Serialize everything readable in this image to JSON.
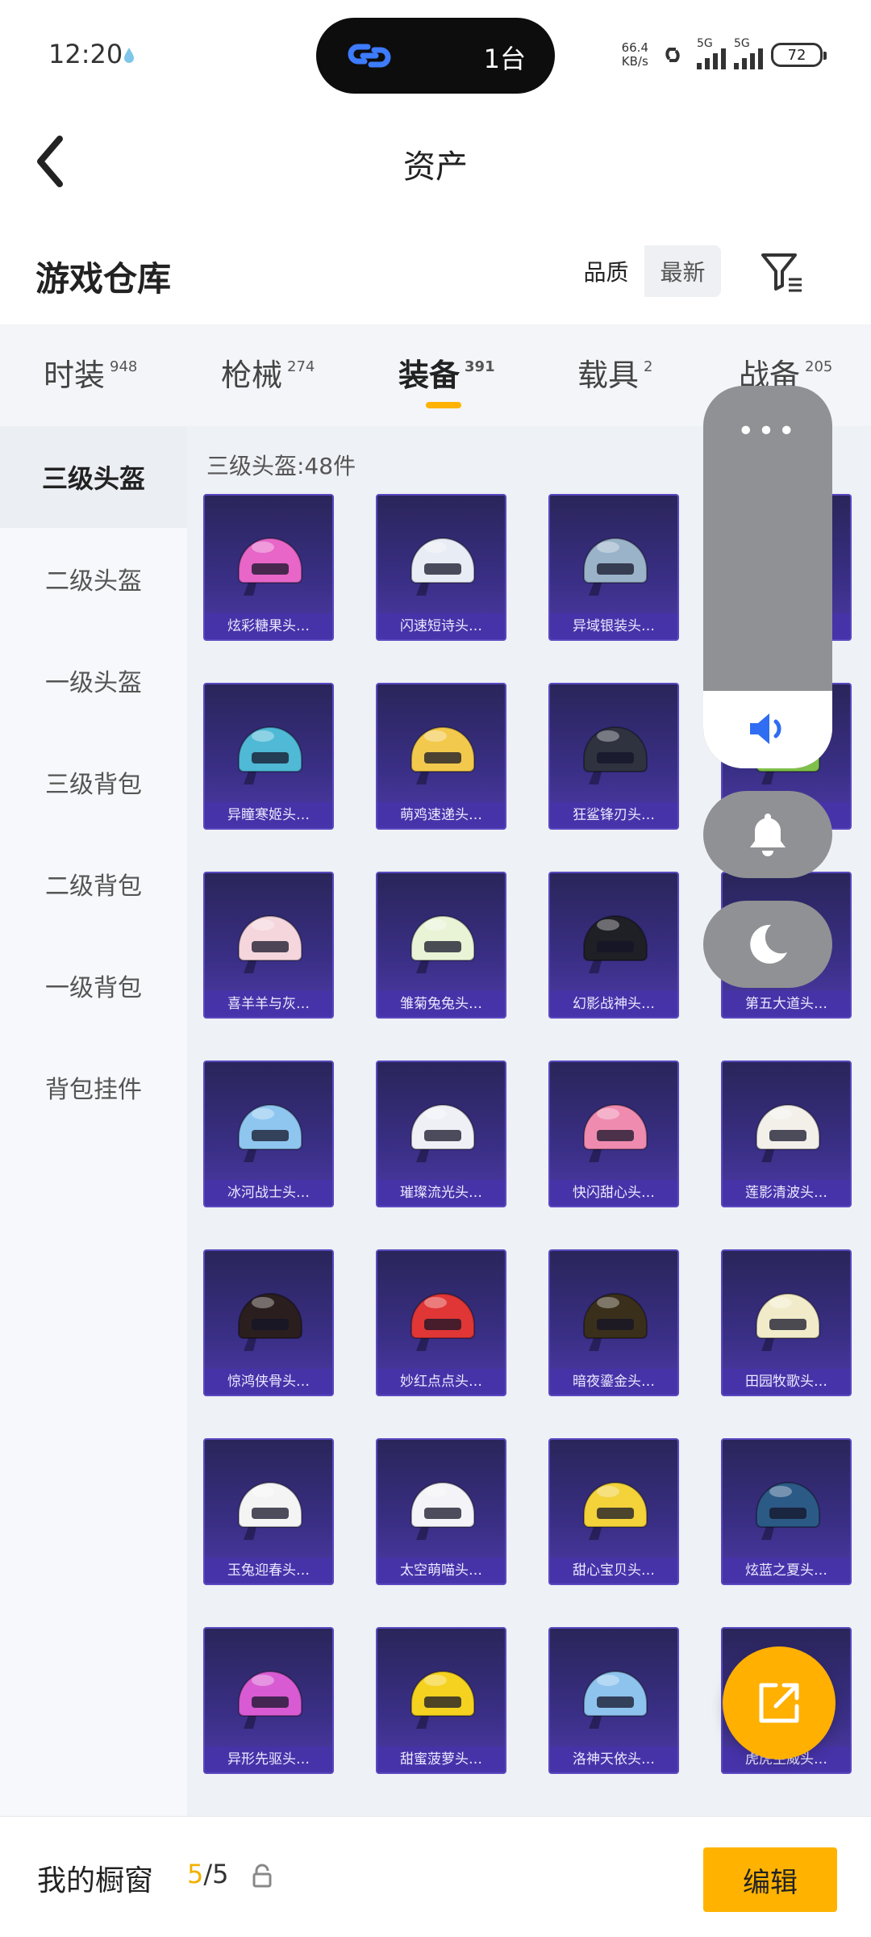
{
  "status_bar": {
    "time": "12:20",
    "island_text": "1台",
    "net_speed_top": "66.4",
    "net_speed_unit": "KB/s",
    "sig1_label": "5G",
    "sig2_label": "5G",
    "battery": "72"
  },
  "header": {
    "title": "资产"
  },
  "warehouse": {
    "title": "游戏仓库",
    "sort_options": [
      "品质",
      "最新"
    ],
    "sort_selected": "品质"
  },
  "tabs": [
    {
      "label": "时装",
      "count": "948"
    },
    {
      "label": "枪械",
      "count": "274"
    },
    {
      "label": "装备",
      "count": "391"
    },
    {
      "label": "载具",
      "count": "2"
    },
    {
      "label": "战备",
      "count": "205"
    }
  ],
  "active_tab": "装备",
  "sidebar": {
    "items": [
      "三级头盔",
      "二级头盔",
      "一级头盔",
      "三级背包",
      "二级背包",
      "一级背包",
      "背包挂件"
    ],
    "active": "三级头盔"
  },
  "content": {
    "section_label": "三级头盔:48件",
    "items": [
      {
        "name": "炫彩糖果头…",
        "color": "#e766c8"
      },
      {
        "name": "闪速短诗头…",
        "color": "#e8ecf5"
      },
      {
        "name": "异域银装头…",
        "color": "#9bb3c9"
      },
      {
        "name": "",
        "color": "#5b6bd1"
      },
      {
        "name": "异瞳寒姬头…",
        "color": "#4fb9d6"
      },
      {
        "name": "萌鸡速递头…",
        "color": "#f2c94c"
      },
      {
        "name": "狂鲨锋刃头…",
        "color": "#2f3340"
      },
      {
        "name": "",
        "color": "#7fbf4a"
      },
      {
        "name": "喜羊羊与灰…",
        "color": "#f5d6dc"
      },
      {
        "name": "雏菊兔兔头…",
        "color": "#e9f3d6"
      },
      {
        "name": "幻影战神头…",
        "color": "#1f1f26"
      },
      {
        "name": "第五大道头…",
        "color": "#2f3a44"
      },
      {
        "name": "冰河战士头…",
        "color": "#8ec6f0"
      },
      {
        "name": "璀璨流光头…",
        "color": "#eef0f5"
      },
      {
        "name": "快闪甜心头…",
        "color": "#f08bb0"
      },
      {
        "name": "莲影清波头…",
        "color": "#f3f0ea"
      },
      {
        "name": "惊鸿侠骨头…",
        "color": "#2b1e1e"
      },
      {
        "name": "妙红点点头…",
        "color": "#e03636"
      },
      {
        "name": "暗夜鎏金头…",
        "color": "#3a2f1a"
      },
      {
        "name": "田园牧歌头…",
        "color": "#f1ebc9"
      },
      {
        "name": "玉兔迎春头…",
        "color": "#f4f4f4"
      },
      {
        "name": "太空萌喵头…",
        "color": "#f3f3f8"
      },
      {
        "name": "甜心宝贝头…",
        "color": "#f3d23a"
      },
      {
        "name": "炫蓝之夏头…",
        "color": "#2c5a86"
      },
      {
        "name": "异形先驱头…",
        "color": "#d85bd3"
      },
      {
        "name": "甜蜜菠萝头…",
        "color": "#f4d21f"
      },
      {
        "name": "洛神天依头…",
        "color": "#8ec3ee"
      },
      {
        "name": "虎虎生威头…",
        "color": "#3b4f7f"
      }
    ]
  },
  "bottom_bar": {
    "showcase_label": "我的橱窗",
    "showcase_used": "5",
    "showcase_total": "/5",
    "edit_label": "编辑"
  },
  "float_panel": {
    "dots": "•••"
  },
  "colors": {
    "accent": "#ffb300",
    "card_bg": "#3a2f86"
  }
}
